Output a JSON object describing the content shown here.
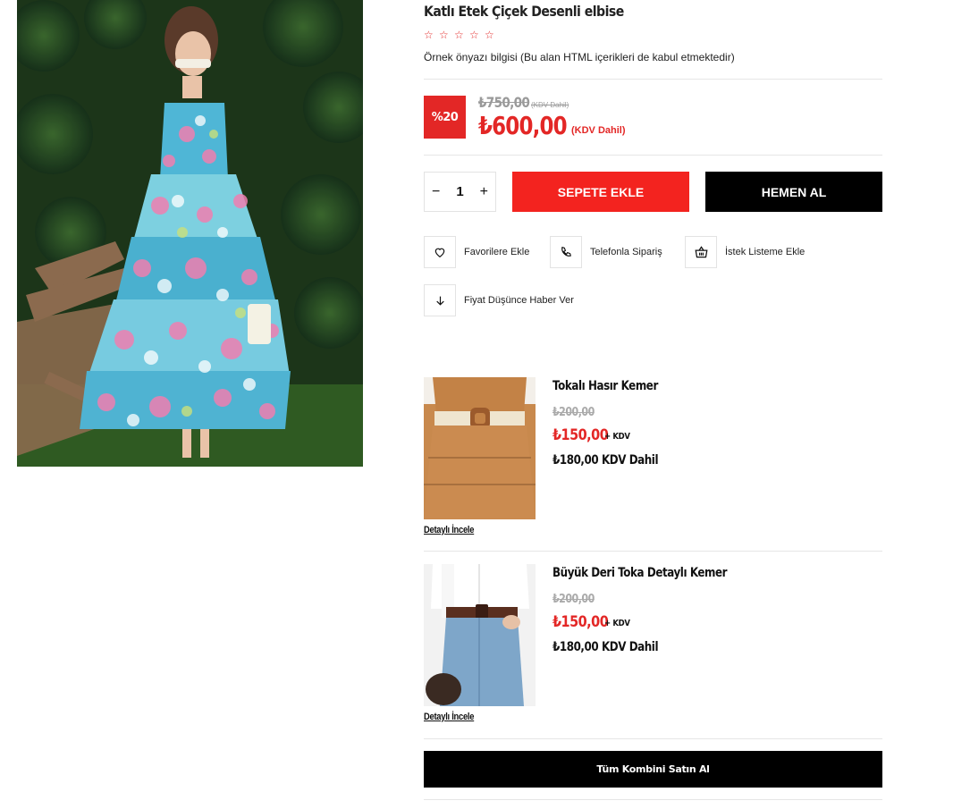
{
  "product": {
    "title": "Katlı Etek Çiçek Desenli elbise",
    "rating_stars": 5,
    "rating_value": 0,
    "description": "Örnek önyazı bilgisi (Bu alan HTML içerikleri de kabul etmektedir)",
    "discount_badge": "%20",
    "old_price": "₺750,00",
    "old_price_note": "(KDV Dahil)",
    "price": "₺600,00",
    "price_note": "(KDV Dahil)",
    "quantity": "1"
  },
  "buttons": {
    "decrement": "−",
    "increment": "+",
    "add_to_cart": "SEPETE EKLE",
    "buy_now": "HEMEN AL",
    "buy_all": "Tüm Kombini Satın Al"
  },
  "actions": [
    {
      "label": "Favorilere Ekle",
      "icon": "heart-icon"
    },
    {
      "label": "Telefonla Sipariş",
      "icon": "phone-icon"
    },
    {
      "label": "İstek Listeme Ekle",
      "icon": "basket-icon"
    },
    {
      "label": "Fiyat Düşünce Haber Ver",
      "icon": "arrow-down-icon"
    }
  ],
  "combos": [
    {
      "name": "Tokalı Hasır Kemer",
      "old_price": "₺200,00",
      "price": "₺150,00",
      "price_suffix": "+ KDV",
      "price_incl": "₺180,00 KDV Dahil",
      "detail_link": "Detaylı İncele"
    },
    {
      "name": "Büyük Deri Toka Detaylı Kemer",
      "old_price": "₺200,00",
      "price": "₺150,00",
      "price_suffix": "+ KDV",
      "price_incl": "₺180,00 KDV Dahil",
      "detail_link": "Detaylı İncele"
    }
  ],
  "colors": {
    "accent_red": "#e32726",
    "button_red": "#f3231f",
    "button_black": "#000000"
  }
}
